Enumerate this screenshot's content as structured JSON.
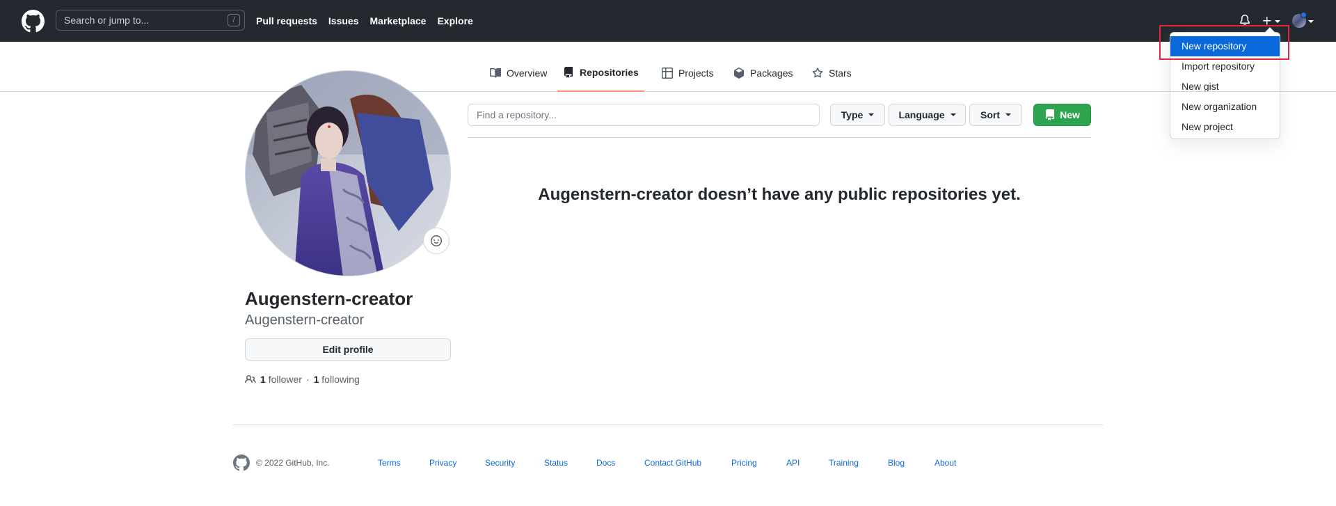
{
  "header": {
    "search_placeholder": "Search or jump to...",
    "search_shortcut": "/",
    "nav": [
      "Pull requests",
      "Issues",
      "Marketplace",
      "Explore"
    ]
  },
  "create_menu": {
    "items": [
      "New repository",
      "Import repository",
      "New gist",
      "New organization",
      "New project"
    ],
    "selected": "New repository"
  },
  "tabs": [
    "Overview",
    "Repositories",
    "Projects",
    "Packages",
    "Stars"
  ],
  "selected_tab": "Repositories",
  "profile": {
    "name": "Augenstern-creator",
    "login": "Augenstern-creator",
    "edit_label": "Edit profile",
    "followers_count": "1",
    "followers_label": "follower",
    "separator": "·",
    "following_count": "1",
    "following_label": "following"
  },
  "repos": {
    "search_placeholder": "Find a repository...",
    "type_label": "Type",
    "language_label": "Language",
    "sort_label": "Sort",
    "new_label": "New",
    "empty_message": "Augenstern-creator doesn’t have any public repositories yet."
  },
  "footer": {
    "copyright": "© 2022 GitHub, Inc.",
    "links": [
      "Terms",
      "Privacy",
      "Security",
      "Status",
      "Docs",
      "Contact GitHub",
      "Pricing",
      "API",
      "Training",
      "Blog",
      "About"
    ]
  },
  "colors": {
    "header_bg": "#24292f",
    "accent_blue": "#0969da",
    "new_button_green": "#2da44e",
    "tab_underline": "#fd8c73",
    "highlight_red": "#e5263b"
  }
}
